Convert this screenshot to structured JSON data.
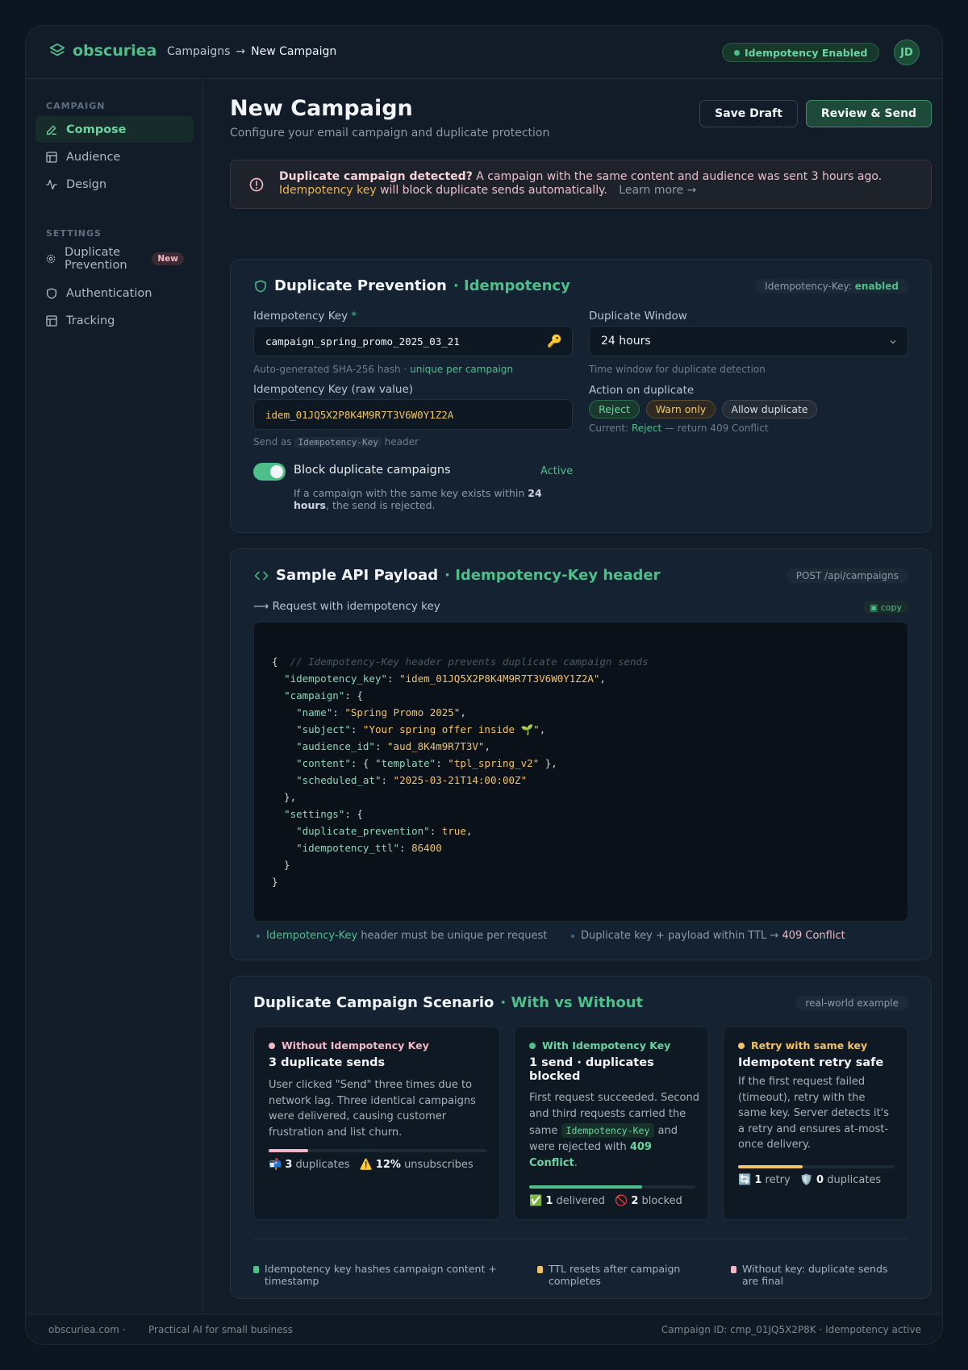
{
  "brand": {
    "name": "obscuriea"
  },
  "breadcrumb": {
    "parent": "Campaigns",
    "separator": "→",
    "current": "New Campaign"
  },
  "header": {
    "status_badge": "Idempotency Enabled",
    "avatar": "JD"
  },
  "sidebar": {
    "campaign_label": "CAMPAIGN",
    "settings_label": "SETTINGS",
    "items": [
      {
        "label": "Compose",
        "icon": "pencil-icon",
        "active": true
      },
      {
        "label": "Audience",
        "icon": "layout-icon"
      },
      {
        "label": "Design",
        "icon": "activity-icon"
      },
      {
        "label": "Duplicate Prevention",
        "icon": "gear-icon",
        "badge": "New"
      },
      {
        "label": "Authentication",
        "icon": "shield-icon"
      },
      {
        "label": "Tracking",
        "icon": "layout-icon"
      }
    ]
  },
  "page": {
    "title": "New Campaign",
    "subtitle": "Configure your email campaign and duplicate protection",
    "save_draft": "Save Draft",
    "review_send": "Review & Send"
  },
  "alert": {
    "title": "Duplicate campaign detected?",
    "body": "A campaign with the same content and audience was sent 3 hours ago.",
    "key": "Idempotency key",
    "body2": "will block duplicate sends automatically.",
    "learn_more": "Learn more →"
  },
  "dup": {
    "title": "Duplicate Prevention",
    "title_accent": "· Idempotency",
    "pill_label": "Idempotency-Key:",
    "pill_value": "enabled",
    "key_label": "Idempotency Key",
    "required_mark": "*",
    "key_value": "campaign_spring_promo_2025_03_21",
    "key_hint": "Auto-generated SHA-256 hash ·",
    "key_hint_accent": "unique per campaign",
    "raw_label": "Idempotency Key (raw value)",
    "raw_value": "idem_01JQ5X2P8K4M9R7T3V6W0Y1Z2A",
    "raw_hint_pre": "Send as",
    "raw_hint_code": "Idempotency-Key",
    "raw_hint_post": "header",
    "window_label": "Duplicate Window",
    "window_value": "24 hours",
    "window_hint": "Time window for duplicate detection",
    "action_label": "Action on duplicate",
    "actions": [
      "Reject",
      "Warn only",
      "Allow duplicate"
    ],
    "current_pre": "Current:",
    "current_value": "Reject",
    "current_post": "— return 409 Conflict",
    "toggle_label": "Block duplicate campaigns",
    "toggle_status": "Active",
    "toggle_desc_pre": "If a campaign with the same key exists within",
    "toggle_desc_bold": "24 hours",
    "toggle_desc_post": ", the send is rejected."
  },
  "api": {
    "title": "Sample API Payload",
    "title_accent": "· Idempotency-Key header",
    "endpoint": "POST /api/campaigns",
    "request_label": "⟶ Request with idempotency key",
    "copy": "▣ copy",
    "code": {
      "comment": "// Idempotency-Key header prevents duplicate campaign sends",
      "idempotency_key": "idem_01JQ5X2P8K4M9R7T3V6W0Y1Z2A",
      "name": "Spring Promo 2025",
      "subject": "Your spring offer inside 🌱",
      "audience_id": "aud_8K4m9R7T3V",
      "template": "tpl_spring_v2",
      "scheduled_at": "2025-03-21T14:00:00Z",
      "duplicate_prevention": "true",
      "idempotency_ttl": "86400"
    },
    "note1_accent": "Idempotency-Key",
    "note1_text": "header must be unique per request",
    "note2_text": "Duplicate key + payload within TTL →",
    "note2_accent": "409 Conflict"
  },
  "scenario": {
    "title": "Duplicate Campaign Scenario",
    "title_accent": "· With vs Without",
    "pill": "real-world example",
    "cards": [
      {
        "label": "Without Idempotency Key",
        "title": "3 duplicate sends",
        "desc": "User clicked \"Send\" three times due to network lag. Three identical campaigns were delivered, causing customer frustration and list churn.",
        "progress": 0.18,
        "stat1_icon": "📬",
        "stat1_value": "3",
        "stat1_label": "duplicates",
        "stat2_icon": "⚠️",
        "stat2_value": "12%",
        "stat2_label": "unsubscribes"
      },
      {
        "label": "With Idempotency Key",
        "title": "1 send · duplicates blocked",
        "desc_pre": "First request succeeded. Second and third requests carried the same",
        "desc_code": "Idempotency-Key",
        "desc_mid": "and were rejected with",
        "desc_bold": "409 Conflict",
        "desc_end": ".",
        "progress": 0.68,
        "stat1_icon": "✅",
        "stat1_value": "1",
        "stat1_label": "delivered",
        "stat2_icon": "🚫",
        "stat2_value": "2",
        "stat2_label": "blocked"
      },
      {
        "label": "Retry with same key",
        "title": "Idempotent retry safe",
        "desc": "If the first request failed (timeout), retry with the same key. Server detects it's a retry and ensures at-most-once delivery.",
        "progress": 0.41,
        "stat1_icon": "🔄",
        "stat1_value": "1",
        "stat1_label": "retry",
        "stat2_icon": "🛡️",
        "stat2_value": "0",
        "stat2_label": "duplicates"
      }
    ],
    "legend": [
      "Idempotency key hashes campaign content + timestamp",
      "TTL resets after campaign completes",
      "Without key: duplicate sends are final"
    ]
  },
  "footer": {
    "site": "obscuriea.com",
    "sep": "·",
    "tagline": "Practical AI for small business",
    "campaign_info": "Campaign ID: cmp_01JQ5X2P8K · Idempotency active"
  },
  "colors": {
    "accent": "#4fbf8a",
    "amber": "#f0c36b",
    "pink": "#f2b8c6",
    "bg": "#0d1520"
  }
}
